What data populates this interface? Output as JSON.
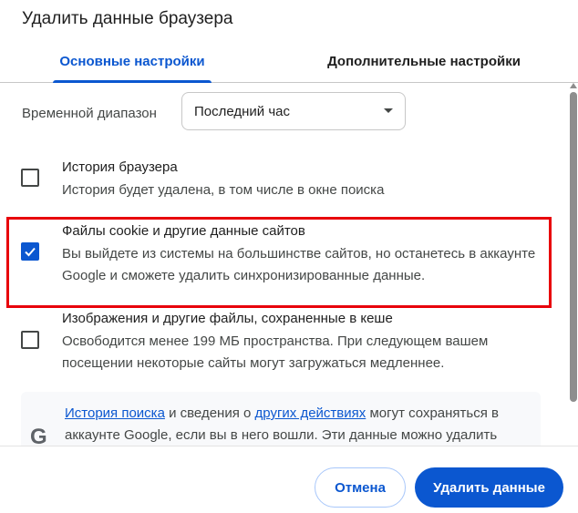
{
  "dialog": {
    "title": "Удалить данные браузера"
  },
  "tabs": [
    {
      "label": "Основные настройки",
      "active": true
    },
    {
      "label": "Дополнительные настройки",
      "active": false
    }
  ],
  "time_range": {
    "label": "Временной диапазон",
    "selected": "Последний час"
  },
  "items": [
    {
      "title": "История браузера",
      "description": "История будет удалена, в том числе в окне поиска",
      "checked": false
    },
    {
      "title": "Файлы cookie и другие данные сайтов",
      "description": "Вы выйдете из системы на большинстве сайтов, но останетесь в аккаунте Google и сможете удалить синхронизированные данные.",
      "checked": true
    },
    {
      "title": "Изображения и другие файлы, сохраненные в кеше",
      "description": "Освободится менее 199 МБ пространства. При следующем вашем посещении некоторые сайты могут загружаться медленнее.",
      "checked": false
    }
  ],
  "info": {
    "logo": "G",
    "link1": "История поиска",
    "text1": " и сведения о ",
    "link2": "других действиях",
    "text2": " могут сохраняться в аккаунте Google, если вы в него вошли. Эти данные можно удалить"
  },
  "footer": {
    "cancel_label": "Отмена",
    "delete_label": "Удалить данные"
  },
  "colors": {
    "accent": "#0b57d0",
    "highlight_border": "#e8000b"
  }
}
